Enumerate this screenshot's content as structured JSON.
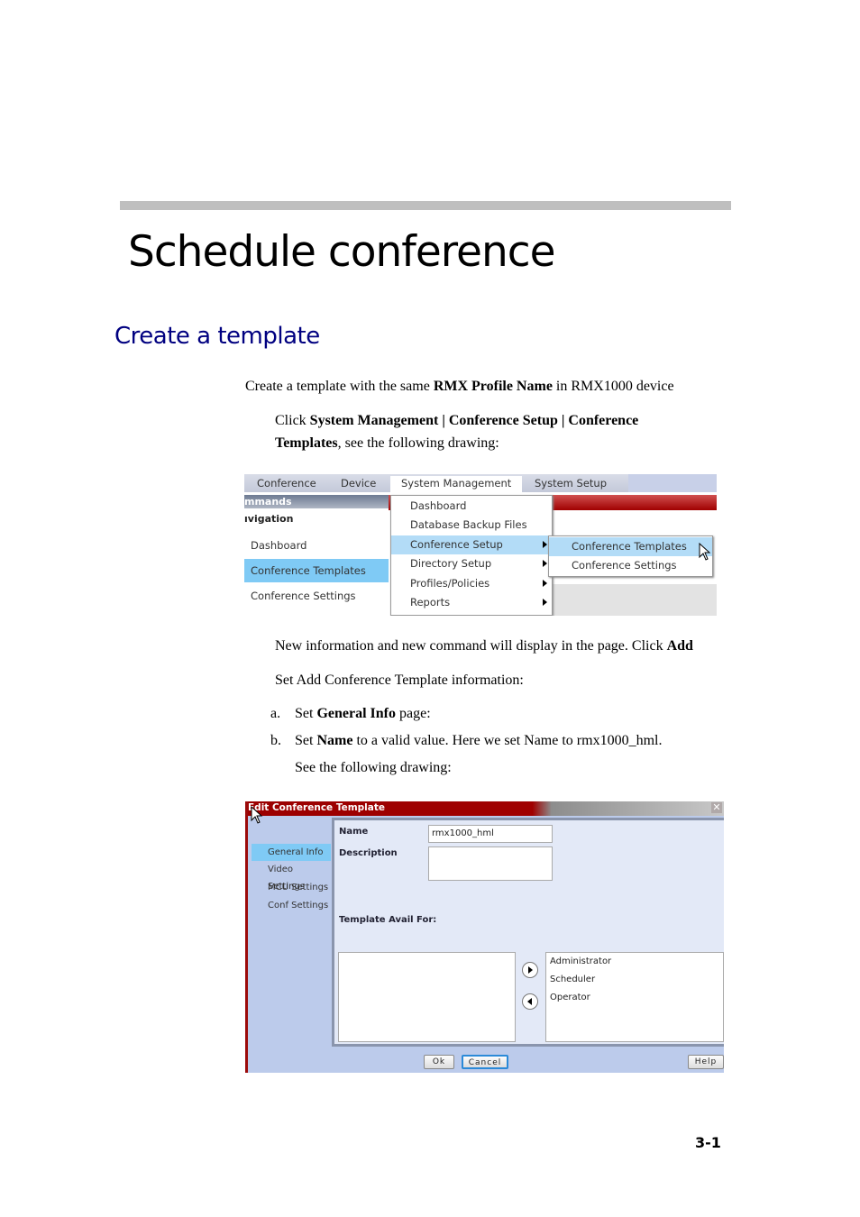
{
  "chapter": {
    "title": "Schedule conference"
  },
  "section": {
    "title": "Create a template"
  },
  "intro": {
    "pre": "Create a template with the same ",
    "bold": "RMX Profile Name",
    "post": " in RMX1000 device"
  },
  "step1": {
    "pre": "Click ",
    "bold1": "System Management | Conference Setup | Conference",
    "bold2": "Templates",
    "post": ", see the following drawing:"
  },
  "screenshot1": {
    "tabs": [
      "Conference",
      "Device",
      "System Management",
      "System Setup"
    ],
    "commands_label": "mmands",
    "navigation_label": "ıvigation",
    "nav_items": [
      "Dashboard",
      "Conference Templates",
      "Conference Settings"
    ],
    "menu_items": [
      "Dashboard",
      "Database Backup Files",
      "Conference Setup",
      "Directory Setup",
      "Profiles/Policies",
      "Reports"
    ],
    "submenu_items": [
      "Conference Templates",
      "Conference Settings"
    ]
  },
  "step2": {
    "pre": "New information and new command will display in the page. Click ",
    "bold": "Add"
  },
  "step3": {
    "text": "Set Add Conference Template information:"
  },
  "list": {
    "a": {
      "marker": "a.",
      "pre": "Set ",
      "bold": "General Info",
      "post": " page:"
    },
    "b": {
      "marker": "b.",
      "pre": "Set ",
      "bold": "Name",
      "post": " to a valid value. Here we set Name to rmx1000_hml."
    },
    "see": "See the following drawing:"
  },
  "screenshot2": {
    "title": "Edit Conference Template",
    "close": "✕",
    "side_items": [
      "General Info",
      "Video Settings",
      "MCU Settings",
      "Conf Settings"
    ],
    "name_label": "Name",
    "name_value": "rmx1000_hml",
    "description_label": "Description",
    "description_value": "",
    "avail_label": "Template Avail For:",
    "available_items": [
      "Administrator",
      "Scheduler",
      "Operator"
    ],
    "buttons": {
      "ok": "Ok",
      "cancel": "Cancel",
      "help": "Help"
    }
  },
  "footer": {
    "page": "3-1"
  }
}
